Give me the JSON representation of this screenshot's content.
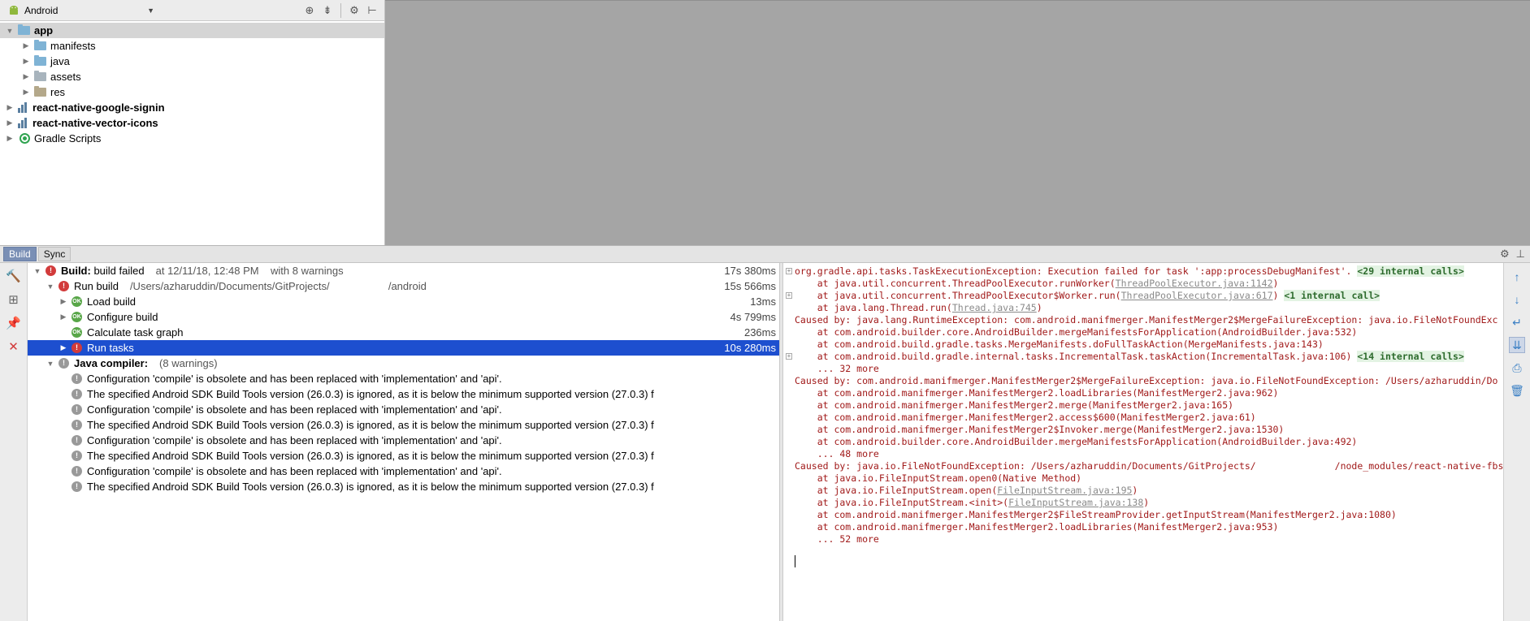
{
  "project_panel": {
    "view_label": "Android",
    "tree": [
      {
        "label": "app",
        "bold": true,
        "level": 0,
        "icon": "folder",
        "expanded": true
      },
      {
        "label": "manifests",
        "bold": false,
        "level": 1,
        "icon": "folder",
        "expanded": false
      },
      {
        "label": "java",
        "bold": false,
        "level": 1,
        "icon": "folder",
        "expanded": false
      },
      {
        "label": "assets",
        "bold": false,
        "level": 1,
        "icon": "folder-grey",
        "expanded": false
      },
      {
        "label": "res",
        "bold": false,
        "level": 1,
        "icon": "folder-res",
        "expanded": false
      },
      {
        "label": "react-native-google-signin",
        "bold": true,
        "level": 0,
        "icon": "module",
        "expanded": false
      },
      {
        "label": "react-native-vector-icons",
        "bold": true,
        "level": 0,
        "icon": "module",
        "expanded": false
      },
      {
        "label": "Gradle Scripts",
        "bold": false,
        "level": 0,
        "icon": "gradle",
        "expanded": false
      }
    ]
  },
  "build_tabs": {
    "build": "Build",
    "sync": "Sync"
  },
  "build_tree": [
    {
      "level": 0,
      "status": "error",
      "label": "Build:",
      "label_suffix": " build failed",
      "detail": "at 12/11/18, 12:48 PM    with 8 warnings",
      "time": "17s 380ms",
      "arrow": "down"
    },
    {
      "level": 1,
      "status": "error",
      "label": "Run build",
      "label_suffix": "",
      "detail": "/Users/azharuddin/Documents/GitProjects/                    /android",
      "time": "15s 566ms",
      "arrow": "down"
    },
    {
      "level": 2,
      "status": "ok",
      "label": "Load build",
      "label_suffix": "",
      "detail": "",
      "time": "13ms",
      "arrow": "right"
    },
    {
      "level": 2,
      "status": "ok",
      "label": "Configure build",
      "label_suffix": "",
      "detail": "",
      "time": "4s 799ms",
      "arrow": "right"
    },
    {
      "level": 2,
      "status": "ok",
      "label": "Calculate task graph",
      "label_suffix": "",
      "detail": "",
      "time": "236ms",
      "arrow": "none"
    },
    {
      "level": 2,
      "status": "error",
      "label": "Run tasks",
      "label_suffix": "",
      "detail": "",
      "time": "10s 280ms",
      "arrow": "right",
      "selected": true
    },
    {
      "level": 1,
      "status": "warn",
      "label": "Java compiler:",
      "label_suffix": "",
      "detail": "(8 warnings)",
      "time": "",
      "arrow": "down",
      "bold_label": true
    },
    {
      "level": 2,
      "status": "warn",
      "label": "Configuration 'compile' is obsolete and has been replaced with 'implementation' and 'api'.",
      "label_suffix": "",
      "detail": "",
      "time": "",
      "arrow": "none"
    },
    {
      "level": 2,
      "status": "warn",
      "label": "The specified Android SDK Build Tools version (26.0.3) is ignored, as it is below the minimum supported version (27.0.3) f",
      "label_suffix": "",
      "detail": "",
      "time": "",
      "arrow": "none"
    },
    {
      "level": 2,
      "status": "warn",
      "label": "Configuration 'compile' is obsolete and has been replaced with 'implementation' and 'api'.",
      "label_suffix": "",
      "detail": "",
      "time": "",
      "arrow": "none"
    },
    {
      "level": 2,
      "status": "warn",
      "label": "The specified Android SDK Build Tools version (26.0.3) is ignored, as it is below the minimum supported version (27.0.3) f",
      "label_suffix": "",
      "detail": "",
      "time": "",
      "arrow": "none"
    },
    {
      "level": 2,
      "status": "warn",
      "label": "Configuration 'compile' is obsolete and has been replaced with 'implementation' and 'api'.",
      "label_suffix": "",
      "detail": "",
      "time": "",
      "arrow": "none"
    },
    {
      "level": 2,
      "status": "warn",
      "label": "The specified Android SDK Build Tools version (26.0.3) is ignored, as it is below the minimum supported version (27.0.3) f",
      "label_suffix": "",
      "detail": "",
      "time": "",
      "arrow": "none"
    },
    {
      "level": 2,
      "status": "warn",
      "label": "Configuration 'compile' is obsolete and has been replaced with 'implementation' and 'api'.",
      "label_suffix": "",
      "detail": "",
      "time": "",
      "arrow": "none"
    },
    {
      "level": 2,
      "status": "warn",
      "label": "The specified Android SDK Build Tools version (26.0.3) is ignored, as it is below the minimum supported version (27.0.3) f",
      "label_suffix": "",
      "detail": "",
      "time": "",
      "arrow": "none"
    }
  ],
  "console": [
    {
      "fold": true,
      "parts": [
        {
          "t": "org.gradle.api.tasks.TaskExecutionException: Execution failed for task ':app:processDebugManifest'. "
        },
        {
          "t": "<29 internal calls>",
          "k": "internal"
        }
      ]
    },
    {
      "fold": false,
      "parts": [
        {
          "t": "    at java.util.concurrent.ThreadPoolExecutor.runWorker("
        },
        {
          "t": "ThreadPoolExecutor.java:1142",
          "k": "link"
        },
        {
          "t": ")"
        }
      ]
    },
    {
      "fold": true,
      "parts": [
        {
          "t": "    at java.util.concurrent.ThreadPoolExecutor$Worker.run("
        },
        {
          "t": "ThreadPoolExecutor.java:617",
          "k": "link"
        },
        {
          "t": ") "
        },
        {
          "t": "<1 internal call>",
          "k": "internal"
        }
      ]
    },
    {
      "fold": false,
      "parts": [
        {
          "t": "    at java.lang.Thread.run("
        },
        {
          "t": "Thread.java:745",
          "k": "link"
        },
        {
          "t": ")"
        }
      ]
    },
    {
      "fold": false,
      "parts": [
        {
          "t": "Caused by: java.lang.RuntimeException: com.android.manifmerger.ManifestMerger2$MergeFailureException: java.io.FileNotFoundExc"
        }
      ]
    },
    {
      "fold": false,
      "parts": [
        {
          "t": "    at com.android.builder.core.AndroidBuilder.mergeManifestsForApplication(AndroidBuilder.java:532)"
        }
      ]
    },
    {
      "fold": false,
      "parts": [
        {
          "t": "    at com.android.build.gradle.tasks.MergeManifests.doFullTaskAction(MergeManifests.java:143)"
        }
      ]
    },
    {
      "fold": true,
      "parts": [
        {
          "t": "    at com.android.build.gradle.internal.tasks.IncrementalTask.taskAction(IncrementalTask.java:106) "
        },
        {
          "t": "<14 internal calls>",
          "k": "internal"
        }
      ]
    },
    {
      "fold": false,
      "parts": [
        {
          "t": "    ... 32 more"
        }
      ]
    },
    {
      "fold": false,
      "parts": [
        {
          "t": "Caused by: com.android.manifmerger.ManifestMerger2$MergeFailureException: java.io.FileNotFoundException: /Users/azharuddin/Do"
        }
      ]
    },
    {
      "fold": false,
      "parts": [
        {
          "t": "    at com.android.manifmerger.ManifestMerger2.loadLibraries(ManifestMerger2.java:962)"
        }
      ]
    },
    {
      "fold": false,
      "parts": [
        {
          "t": "    at com.android.manifmerger.ManifestMerger2.merge(ManifestMerger2.java:165)"
        }
      ]
    },
    {
      "fold": false,
      "parts": [
        {
          "t": "    at com.android.manifmerger.ManifestMerger2.access$600(ManifestMerger2.java:61)"
        }
      ]
    },
    {
      "fold": false,
      "parts": [
        {
          "t": "    at com.android.manifmerger.ManifestMerger2$Invoker.merge(ManifestMerger2.java:1530)"
        }
      ]
    },
    {
      "fold": false,
      "parts": [
        {
          "t": "    at com.android.builder.core.AndroidBuilder.mergeManifestsForApplication(AndroidBuilder.java:492)"
        }
      ]
    },
    {
      "fold": false,
      "parts": [
        {
          "t": "    ... 48 more"
        }
      ]
    },
    {
      "fold": false,
      "parts": [
        {
          "t": "Caused by: java.io.FileNotFoundException: /Users/azharuddin/Documents/GitProjects/              /node_modules/react-native-fbsd"
        }
      ]
    },
    {
      "fold": false,
      "parts": [
        {
          "t": "    at java.io.FileInputStream.open0(Native Method)"
        }
      ]
    },
    {
      "fold": false,
      "parts": [
        {
          "t": "    at java.io.FileInputStream.open("
        },
        {
          "t": "FileInputStream.java:195",
          "k": "link"
        },
        {
          "t": ")"
        }
      ]
    },
    {
      "fold": false,
      "parts": [
        {
          "t": "    at java.io.FileInputStream.<init>("
        },
        {
          "t": "FileInputStream.java:138",
          "k": "link"
        },
        {
          "t": ")"
        }
      ]
    },
    {
      "fold": false,
      "parts": [
        {
          "t": "    at com.android.manifmerger.ManifestMerger2$FileStreamProvider.getInputStream(ManifestMerger2.java:1080)"
        }
      ]
    },
    {
      "fold": false,
      "parts": [
        {
          "t": "    at com.android.manifmerger.ManifestMerger2.loadLibraries(ManifestMerger2.java:953)"
        }
      ]
    },
    {
      "fold": false,
      "parts": [
        {
          "t": "    ... 52 more"
        }
      ]
    }
  ],
  "icons": {
    "project_toolbar": [
      "target-icon",
      "collapse-all-icon",
      "gear-icon",
      "hide-panel-icon"
    ],
    "left_toolbar": [
      "rebuild-hammer-icon",
      "toggle-view-icon",
      "pin-icon",
      "stop-icon"
    ],
    "right_toolbar": [
      "up-arrow-icon",
      "down-arrow-icon",
      "soft-wrap-icon",
      "scroll-to-end-icon",
      "print-icon",
      "trash-icon"
    ]
  },
  "colors": {
    "selection": "#1d4fcf",
    "error": "#d23b3b",
    "ok": "#58a648",
    "console_text": "#a11a1a",
    "editor_bg": "#a5a5a5"
  }
}
